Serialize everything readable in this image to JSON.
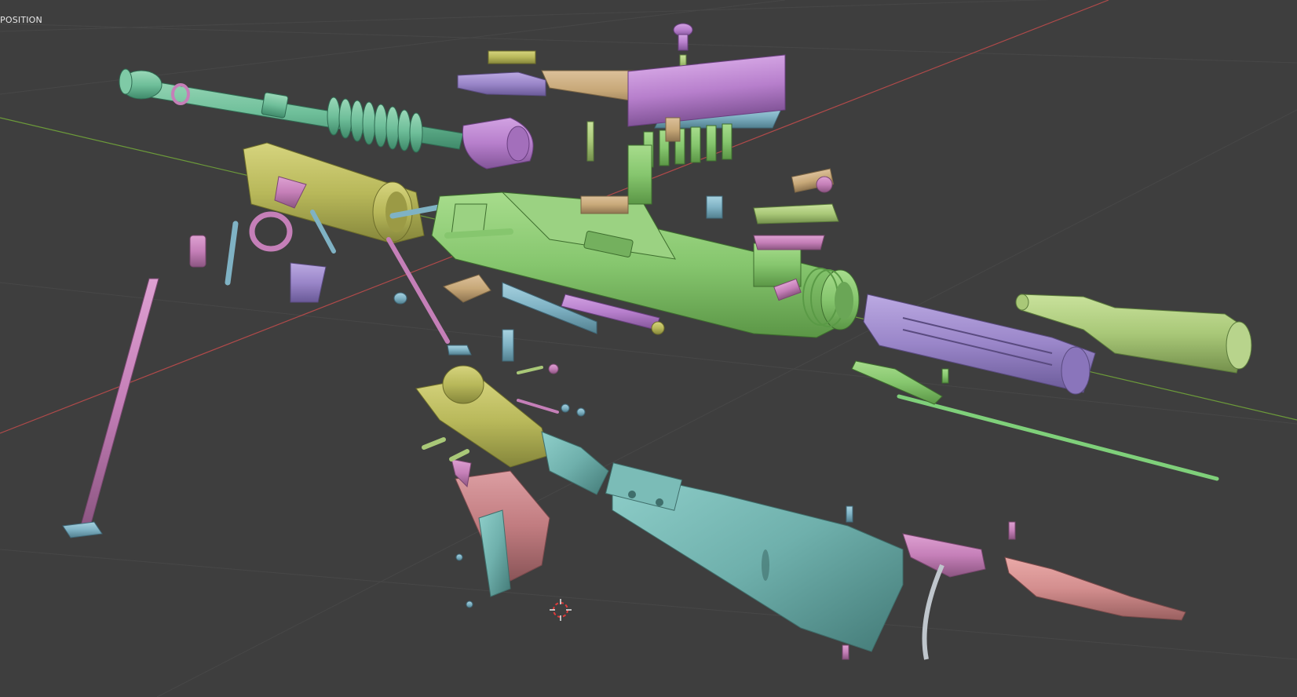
{
  "viewport": {
    "view_label": "POSITION",
    "mode": "exploded-view",
    "background_color": "#3e3e3e"
  },
  "axes": {
    "x_axis_color": "#b04a4a",
    "y_axis_color": "#6c9a3a",
    "grid_color": "#4a4a4a"
  },
  "part_colors": {
    "barrel_green": "#6fbf9a",
    "receiver_green": "#86c66e",
    "olive": "#b8b85a",
    "tan": "#c7a878",
    "violet": "#9a86c9",
    "purple": "#b77fcc",
    "pink": "#c57fb8",
    "rose": "#c17c80",
    "steel_blue": "#7fb2c4",
    "teal_stock": "#6fb0ac",
    "lime": "#a9c878",
    "salmon": "#d38e8e"
  },
  "icons": {
    "cursor": "3d-cursor-icon"
  }
}
